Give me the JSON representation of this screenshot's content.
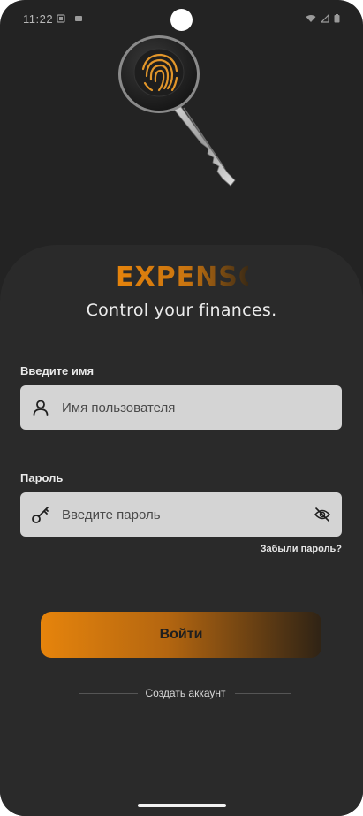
{
  "status_bar": {
    "time": "11:22"
  },
  "brand": {
    "name": "EXPENSO",
    "tagline": "Control your finances."
  },
  "username": {
    "label": "Введите имя",
    "placeholder": "Имя пользователя",
    "icon": "user-icon"
  },
  "password": {
    "label": "Пароль",
    "placeholder": "Введите пароль",
    "icon": "key-icon",
    "toggle_icon": "eye-off-icon"
  },
  "forgot_password": "Забыли пароль?",
  "login_button": "Войти",
  "create_account": "Создать аккаунт",
  "colors": {
    "accent": "#e6840c",
    "background": "#232323",
    "input_bg": "#d4d4d4"
  }
}
